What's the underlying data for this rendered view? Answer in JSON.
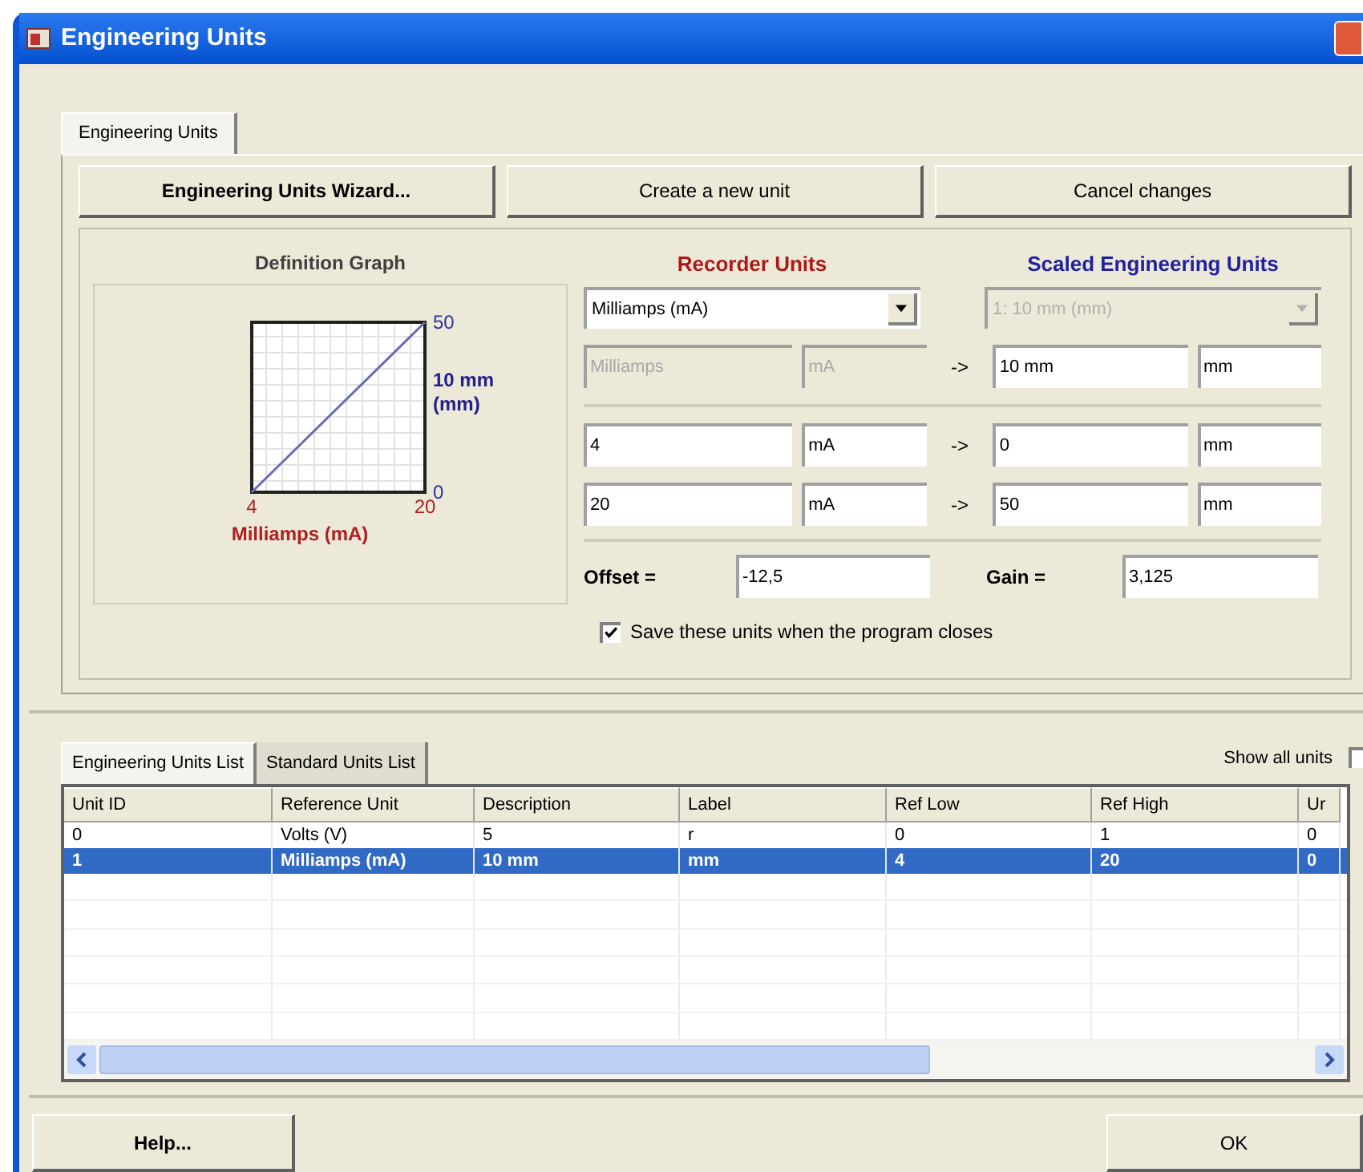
{
  "window": {
    "title": "Engineering Units"
  },
  "tabs": [
    {
      "label": "Engineering Units",
      "selected": true
    }
  ],
  "toolbar": [
    {
      "label": "Engineering Units Wizard...",
      "bold": true
    },
    {
      "label": "Create a new unit",
      "bold": false
    },
    {
      "label": "Cancel changes",
      "bold": false
    }
  ],
  "definition_graph": {
    "title": "Definition Graph",
    "chart_data": {
      "type": "line",
      "xlabel": "Milliamps (mA)",
      "ylabel": "10 mm (mm)",
      "x": [
        4,
        20
      ],
      "series": [
        {
          "color": "#6a6ab8",
          "values": [
            0,
            50
          ]
        }
      ],
      "xticks": [
        4,
        20
      ],
      "yticks": [
        0,
        50
      ],
      "xlim": [
        4,
        20
      ],
      "ylim": [
        0,
        50
      ]
    }
  },
  "recorder_units": {
    "title": "Recorder Units",
    "combo": {
      "value": "Milliamps (mA)",
      "disabled": false
    }
  },
  "scaled_units": {
    "title": "Scaled Engineering Units",
    "combo": {
      "value": "1: 10 mm (mm)",
      "disabled": true
    }
  },
  "mapping_rows": [
    {
      "recorder": [
        {
          "value": "Milliamps",
          "disabled": true
        },
        {
          "value": "mA",
          "disabled": true
        }
      ],
      "arrow": "->",
      "scaled": [
        {
          "value": "10 mm",
          "disabled": false
        },
        {
          "value": "mm",
          "disabled": false
        }
      ]
    },
    {
      "recorder": [
        {
          "value": "4",
          "disabled": false
        },
        {
          "value": "mA",
          "disabled": false
        }
      ],
      "arrow": "->",
      "scaled": [
        {
          "value": "0",
          "disabled": false
        },
        {
          "value": "mm",
          "disabled": false
        }
      ]
    },
    {
      "recorder": [
        {
          "value": "20",
          "disabled": false
        },
        {
          "value": "mA",
          "disabled": false
        }
      ],
      "arrow": "->",
      "scaled": [
        {
          "value": "50",
          "disabled": false
        },
        {
          "value": "mm",
          "disabled": false
        }
      ]
    }
  ],
  "offset": {
    "label": "Offset =",
    "value": "-12,5"
  },
  "gain": {
    "label": "Gain =",
    "value": "3,125"
  },
  "save_checkbox": {
    "label": "Save these units when the program closes",
    "checked": true
  },
  "list_tabs": [
    {
      "label": "Engineering Units List",
      "selected": true
    },
    {
      "label": "Standard Units List",
      "selected": false
    }
  ],
  "show_all_units": {
    "label": "Show all units",
    "checked": false
  },
  "table": {
    "columns": [
      "Unit ID",
      "Reference Unit",
      "Description",
      "Label",
      "Ref Low",
      "Ref High",
      "Ur"
    ],
    "rows": [
      {
        "cells": [
          "0",
          "Volts (V)",
          "5",
          "r",
          "0",
          "1",
          "0"
        ],
        "selected": false
      },
      {
        "cells": [
          "1",
          "Milliamps (mA)",
          "10 mm",
          "mm",
          "4",
          "20",
          "0"
        ],
        "selected": true
      }
    ]
  },
  "buttons": [
    {
      "label": "Help...",
      "bold": true
    },
    {
      "label": "OK",
      "bold": false
    }
  ]
}
